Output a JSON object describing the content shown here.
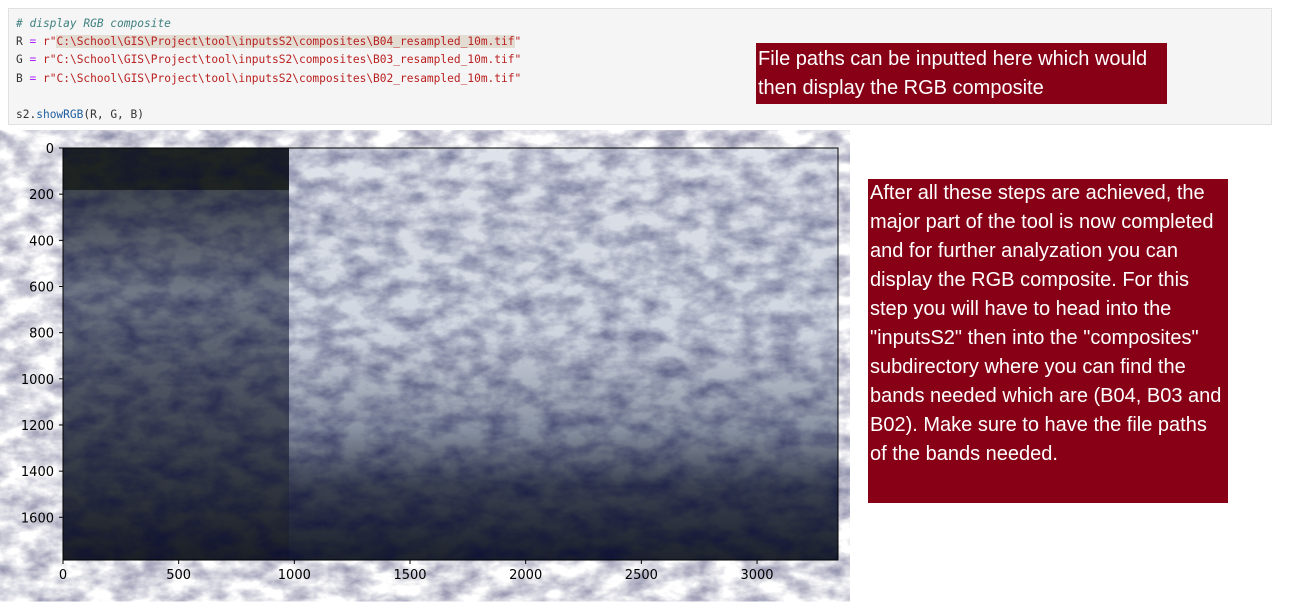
{
  "code_cell": {
    "comment": "# display RGB composite",
    "lines": [
      {
        "var": "R",
        "op": "=",
        "prefix": "r\"",
        "path": "C:\\School\\GIS\\Project\\tool\\inputsS2\\composites\\B04_resampled_10m.tif",
        "suffix": "\""
      },
      {
        "var": "G",
        "op": "=",
        "prefix": "r\"",
        "path": "C:\\School\\GIS\\Project\\tool\\inputsS2\\composites\\B03_resampled_10m.tif",
        "suffix": "\""
      },
      {
        "var": "B",
        "op": "=",
        "prefix": "r\"",
        "path": "C:\\School\\GIS\\Project\\tool\\inputsS2\\composites\\B02_resampled_10m.tif",
        "suffix": "\""
      }
    ],
    "call_obj": "s2.",
    "call_fn": "showRGB",
    "call_args": "(R, G, B)"
  },
  "notes": {
    "note1": "File paths can be inputted here which would then display the RGB composite",
    "note2": "After all these steps are achieved, the major part of the tool is now completed and for further analyzation you can display the RGB composite. For this step you will have to head into the \"inputsS2\" then into the \"composites\" subdirectory where you can find the bands needed which are (B04, B03 and B02). Make sure to have the file paths of the bands needed."
  },
  "plot": {
    "x_ticks": [
      "0",
      "500",
      "1000",
      "1500",
      "2000",
      "2500",
      "3000"
    ],
    "y_ticks": [
      "0",
      "200",
      "400",
      "600",
      "800",
      "1000",
      "1200",
      "1400",
      "1600"
    ]
  },
  "colors": {
    "note_bg": "#880016",
    "cell_bg": "#f5f5f5"
  }
}
